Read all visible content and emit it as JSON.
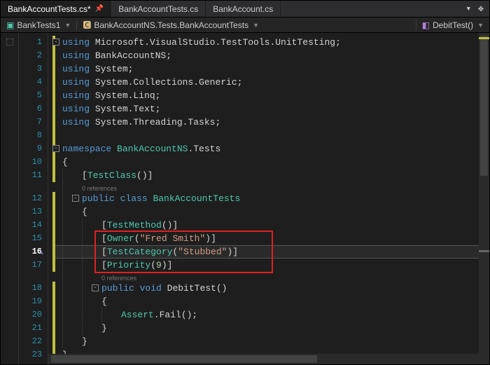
{
  "tabs": [
    {
      "label": "BankAccountTests.cs*",
      "active": true,
      "pinned": true
    },
    {
      "label": "BankAccountTests.cs",
      "active": false,
      "pinned": false
    },
    {
      "label": "BankAccount.cs",
      "active": false,
      "pinned": false
    }
  ],
  "navbar": {
    "scope": "BankTests1",
    "type": "BankAccountNS.Tests.BankAccountTests",
    "member": "DebitTest()"
  },
  "annotations": {
    "codelens": "0 references"
  },
  "code": {
    "lines": [
      {
        "n": 1,
        "frags": [
          [
            "kw",
            "using"
          ],
          [
            "txt",
            " Microsoft.VisualStudio.TestTools.UnitTesting;"
          ]
        ],
        "ind": 0,
        "fold": true,
        "mod": true
      },
      {
        "n": 2,
        "frags": [
          [
            "kw",
            "using"
          ],
          [
            "txt",
            " BankAccountNS;"
          ]
        ],
        "ind": 0,
        "mod": true
      },
      {
        "n": 3,
        "frags": [
          [
            "kw",
            "using"
          ],
          [
            "txt",
            " System;"
          ]
        ],
        "ind": 0,
        "mod": true
      },
      {
        "n": 4,
        "frags": [
          [
            "kw",
            "using"
          ],
          [
            "txt",
            " System.Collections.Generic;"
          ]
        ],
        "ind": 0,
        "mod": true
      },
      {
        "n": 5,
        "frags": [
          [
            "kw",
            "using"
          ],
          [
            "txt",
            " System.Linq;"
          ]
        ],
        "ind": 0,
        "mod": true
      },
      {
        "n": 6,
        "frags": [
          [
            "kw",
            "using"
          ],
          [
            "txt",
            " System.Text;"
          ]
        ],
        "ind": 0,
        "mod": true
      },
      {
        "n": 7,
        "frags": [
          [
            "kw",
            "using"
          ],
          [
            "txt",
            " System.Threading.Tasks;"
          ]
        ],
        "ind": 0,
        "mod": true
      },
      {
        "n": 8,
        "frags": [],
        "ind": 0,
        "mod": true
      },
      {
        "n": 9,
        "frags": [
          [
            "kw",
            "namespace"
          ],
          [
            "txt",
            " "
          ],
          [
            "type",
            "BankAccountNS"
          ],
          [
            "txt",
            ".Tests"
          ]
        ],
        "ind": 0,
        "fold": true,
        "mod": true
      },
      {
        "n": 10,
        "frags": [
          [
            "txt",
            "{"
          ]
        ],
        "ind": 0,
        "mod": true
      },
      {
        "n": 11,
        "frags": [
          [
            "txt",
            "["
          ],
          [
            "type",
            "TestClass"
          ],
          [
            "txt",
            "()]"
          ]
        ],
        "ind": 1,
        "mod": true
      },
      {
        "annot": true,
        "ind": 1
      },
      {
        "n": 12,
        "frags": [
          [
            "kw",
            "public"
          ],
          [
            "txt",
            " "
          ],
          [
            "kw",
            "class"
          ],
          [
            "txt",
            " "
          ],
          [
            "type",
            "BankAccountTests"
          ]
        ],
        "ind": 1,
        "fold": true,
        "mod": true
      },
      {
        "n": 13,
        "frags": [
          [
            "txt",
            "{"
          ]
        ],
        "ind": 1,
        "mod": true
      },
      {
        "n": 14,
        "frags": [
          [
            "txt",
            "["
          ],
          [
            "type",
            "TestMethod"
          ],
          [
            "txt",
            "()]"
          ]
        ],
        "ind": 2,
        "mod": true
      },
      {
        "n": 15,
        "frags": [
          [
            "txt",
            "["
          ],
          [
            "type",
            "Owner"
          ],
          [
            "txt",
            "("
          ],
          [
            "str",
            "\"Fred Smith\""
          ],
          [
            "txt",
            ")]"
          ]
        ],
        "ind": 2,
        "mod": true,
        "red": true
      },
      {
        "n": 16,
        "frags": [
          [
            "txt",
            "["
          ],
          [
            "type",
            "TestCategory"
          ],
          [
            "txt",
            "("
          ],
          [
            "str",
            "\"Stubbed\""
          ],
          [
            "txt",
            ")]"
          ]
        ],
        "ind": 2,
        "mod": true,
        "hl": true,
        "red": true,
        "mark": true
      },
      {
        "n": 17,
        "frags": [
          [
            "txt",
            "["
          ],
          [
            "type",
            "Priority"
          ],
          [
            "txt",
            "("
          ],
          [
            "num",
            "9"
          ],
          [
            "txt",
            ")]"
          ]
        ],
        "ind": 2,
        "mod": true,
        "red": true
      },
      {
        "annot": true,
        "ind": 2
      },
      {
        "n": 18,
        "frags": [
          [
            "kw",
            "public"
          ],
          [
            "txt",
            " "
          ],
          [
            "kw",
            "void"
          ],
          [
            "txt",
            " DebitTest()"
          ]
        ],
        "ind": 2,
        "fold": true,
        "mod": true
      },
      {
        "n": 19,
        "frags": [
          [
            "txt",
            "{"
          ]
        ],
        "ind": 2,
        "mod": true
      },
      {
        "n": 20,
        "frags": [
          [
            "type",
            "Assert"
          ],
          [
            "txt",
            ".Fail();"
          ]
        ],
        "ind": 3,
        "mod": true
      },
      {
        "n": 21,
        "frags": [
          [
            "txt",
            "}"
          ]
        ],
        "ind": 2,
        "mod": true
      },
      {
        "n": 22,
        "frags": [
          [
            "txt",
            "}"
          ]
        ],
        "ind": 1,
        "mod": true
      },
      {
        "n": 23,
        "frags": [
          [
            "txt",
            "}"
          ]
        ],
        "ind": 0,
        "mod": true
      }
    ]
  },
  "colors": {
    "accent": "#569cd6",
    "highlight_border": "#e02020"
  }
}
